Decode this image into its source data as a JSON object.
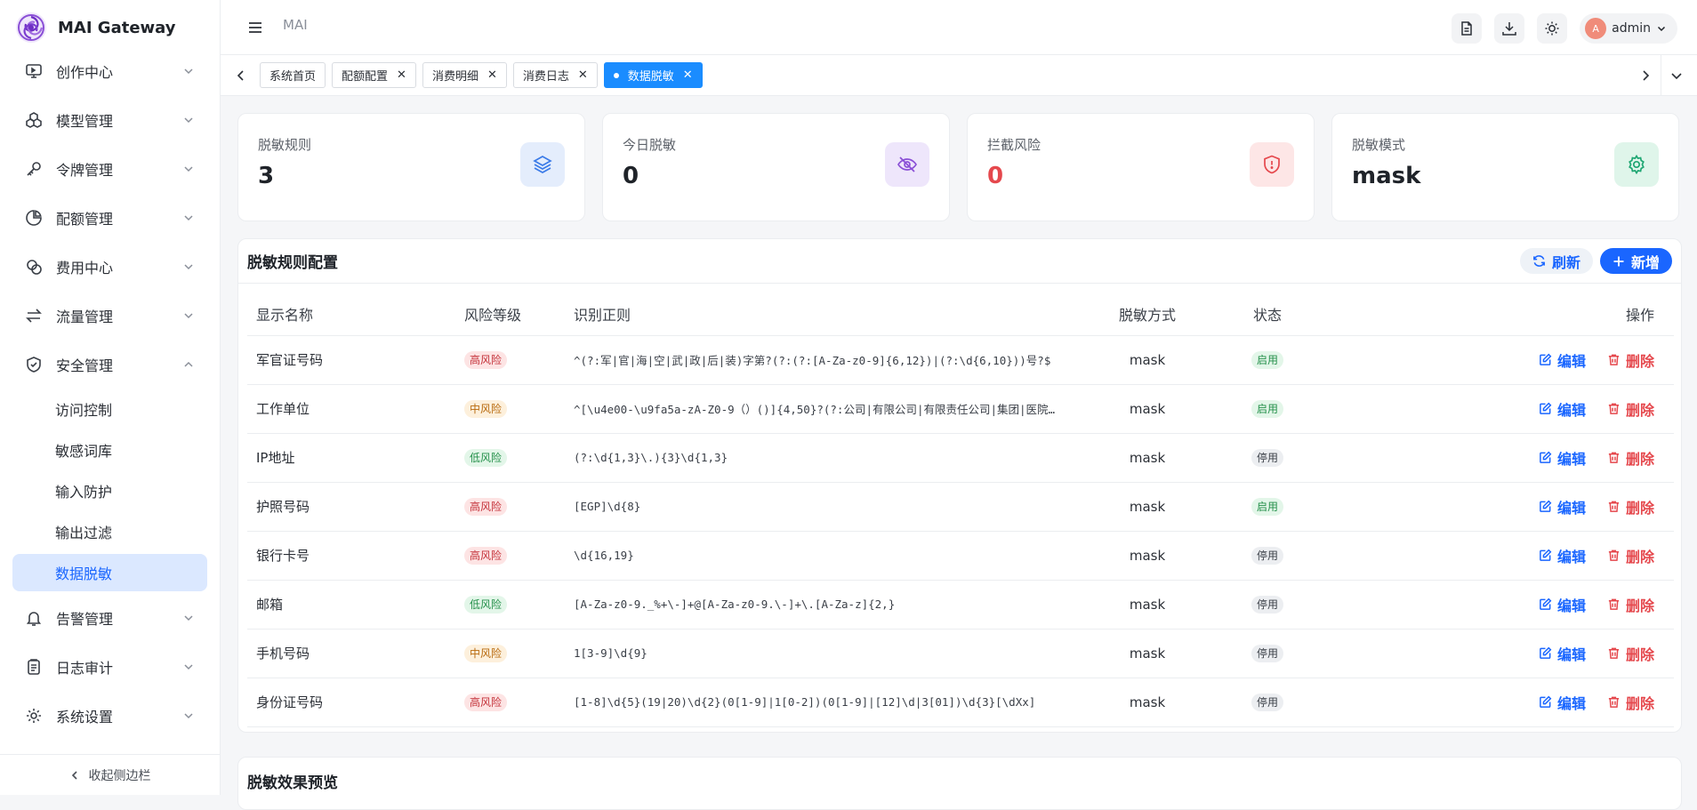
{
  "brand": {
    "name": "MAI Gateway"
  },
  "header": {
    "breadcrumb": "MAI",
    "user": {
      "avatar_letter": "A",
      "name": "admin"
    }
  },
  "sidebar": {
    "items": [
      {
        "label": "创作中心",
        "icon": "monitor-icon"
      },
      {
        "label": "模型管理",
        "icon": "cubes-icon"
      },
      {
        "label": "令牌管理",
        "icon": "key-icon"
      },
      {
        "label": "配额管理",
        "icon": "pie-chart-icon"
      },
      {
        "label": "费用中心",
        "icon": "coins-icon"
      },
      {
        "label": "流量管理",
        "icon": "arrows-swap-icon"
      },
      {
        "label": "安全管理",
        "icon": "shield-check-icon"
      }
    ],
    "security_sub": [
      "访问控制",
      "敏感词库",
      "输入防护",
      "输出过滤",
      "数据脱敏"
    ],
    "items_after": [
      {
        "label": "告警管理",
        "icon": "bell-icon"
      },
      {
        "label": "日志审计",
        "icon": "clipboard-icon"
      },
      {
        "label": "系统设置",
        "icon": "gear-icon"
      }
    ],
    "collapse_label": "收起侧边栏"
  },
  "tabs": [
    {
      "label": "系统首页",
      "closable": false,
      "active": false
    },
    {
      "label": "配额配置",
      "closable": true,
      "active": false
    },
    {
      "label": "消费明细",
      "closable": true,
      "active": false
    },
    {
      "label": "消费日志",
      "closable": true,
      "active": false
    },
    {
      "label": "数据脱敏",
      "closable": true,
      "active": true
    }
  ],
  "stats": [
    {
      "label": "脱敏规则",
      "value": "3"
    },
    {
      "label": "今日脱敏",
      "value": "0"
    },
    {
      "label": "拦截风险",
      "value": "0"
    },
    {
      "label": "脱敏模式",
      "value": "mask"
    }
  ],
  "rules": {
    "title": "脱敏规则配置",
    "refresh_label": "刷新",
    "add_label": "新增",
    "columns": [
      "显示名称",
      "风险等级",
      "识别正则",
      "脱敏方式",
      "状态",
      "操作"
    ],
    "edit_label": "编辑",
    "delete_label": "删除",
    "rows": [
      {
        "name": "军官证号码",
        "risk": "高风险",
        "level": "high",
        "regex": "^(?:军|官|海|空|武|政|后|装)字第?(?:(?:[A-Za-z0-9]{6,12})|(?:\\d{6,10}))号?$",
        "mode": "mask",
        "status": "启用",
        "on": true
      },
      {
        "name": "工作单位",
        "risk": "中风险",
        "level": "mid",
        "regex": "^[\\u4e00-\\u9fa5a-zA-Z0-9（）()]{4,50}?(?:公司|有限公司|有限责任公司|集团|医院…",
        "mode": "mask",
        "status": "启用",
        "on": true
      },
      {
        "name": "IP地址",
        "risk": "低风险",
        "level": "low",
        "regex": "(?:\\d{1,3}\\.){3}\\d{1,3}",
        "mode": "mask",
        "status": "停用",
        "on": false
      },
      {
        "name": "护照号码",
        "risk": "高风险",
        "level": "high",
        "regex": "[EGP]\\d{8}",
        "mode": "mask",
        "status": "启用",
        "on": true
      },
      {
        "name": "银行卡号",
        "risk": "高风险",
        "level": "high",
        "regex": "\\d{16,19}",
        "mode": "mask",
        "status": "停用",
        "on": false
      },
      {
        "name": "邮箱",
        "risk": "低风险",
        "level": "low",
        "regex": "[A-Za-z0-9._%+\\-]+@[A-Za-z0-9.\\-]+\\.[A-Za-z]{2,}",
        "mode": "mask",
        "status": "停用",
        "on": false
      },
      {
        "name": "手机号码",
        "risk": "中风险",
        "level": "mid",
        "regex": "1[3-9]\\d{9}",
        "mode": "mask",
        "status": "停用",
        "on": false
      },
      {
        "name": "身份证号码",
        "risk": "高风险",
        "level": "high",
        "regex": "[1-8]\\d{5}(19|20)\\d{2}(0[1-9]|1[0-2])(0[1-9]|[12]\\d|3[01])\\d{3}[\\dXx]",
        "mode": "mask",
        "status": "停用",
        "on": false
      }
    ]
  },
  "preview": {
    "title": "脱敏效果预览"
  },
  "colors": {
    "primary": "#1a66ff",
    "danger": "#e5484d",
    "success": "#24904a",
    "warning": "#b86a0e"
  }
}
